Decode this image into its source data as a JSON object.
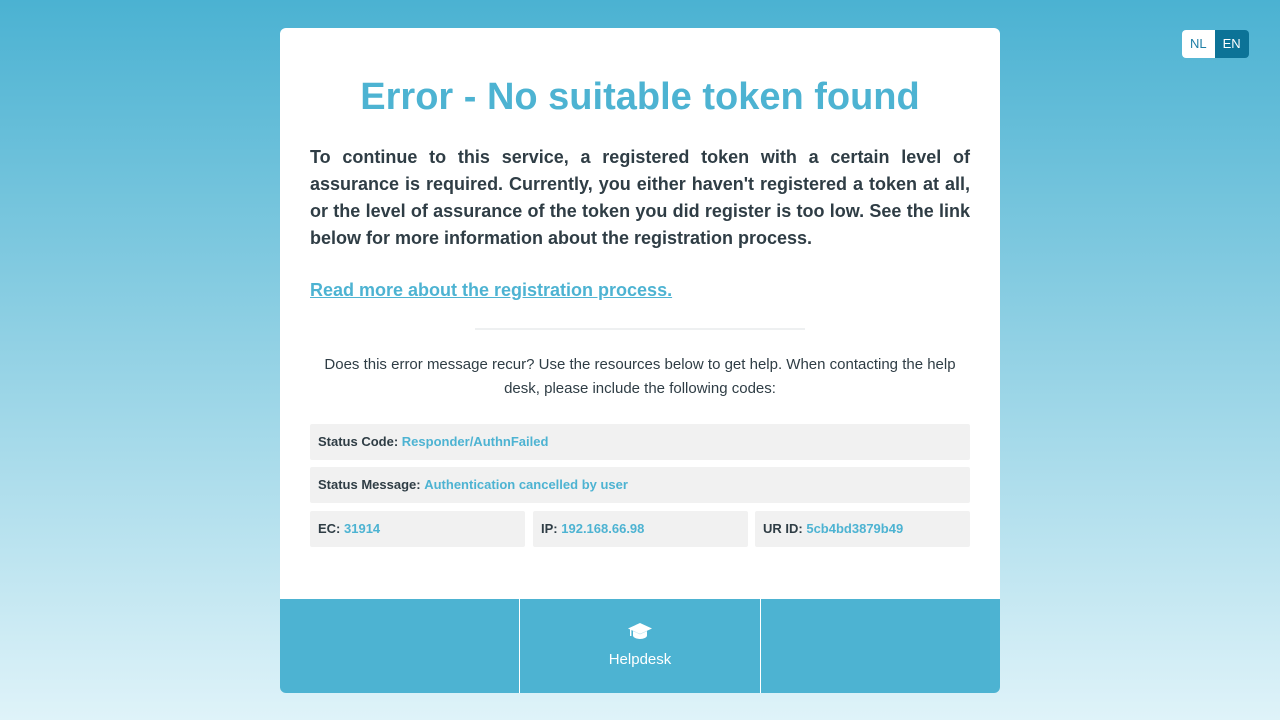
{
  "language_switch": {
    "options": [
      "NL",
      "EN"
    ],
    "selected": "EN"
  },
  "error": {
    "title": "Error - No suitable token found",
    "description": "To continue to this service, a registered token with a certain level of assurance is required. Currently, you either haven't registered a token at all, or the level of assurance of the token you did register is too low. See the link below for more information about the registration process.",
    "link_label": "Read more about the registration process."
  },
  "help": {
    "text": "Does this error message recur? Use the resources below to get help. When contacting the help desk, please include the following codes:"
  },
  "codes": {
    "status_code": {
      "label": "Status Code:",
      "value": "Responder/AuthnFailed"
    },
    "status_message": {
      "label": "Status Message:",
      "value": "Authentication cancelled by user"
    },
    "ec": {
      "label": "EC:",
      "value": "31914"
    },
    "ip": {
      "label": "IP:",
      "value": "192.168.66.98"
    },
    "ur_id": {
      "label": "UR ID:",
      "value": "5cb4bd3879b49"
    }
  },
  "footer": {
    "helpdesk_label": "Helpdesk",
    "helpdesk_icon": "graduation-cap-icon"
  },
  "colors": {
    "accent": "#4db3d2",
    "active_language": "#0c7397",
    "text": "#2f3d45",
    "info_box_bg": "#f1f1f1"
  }
}
